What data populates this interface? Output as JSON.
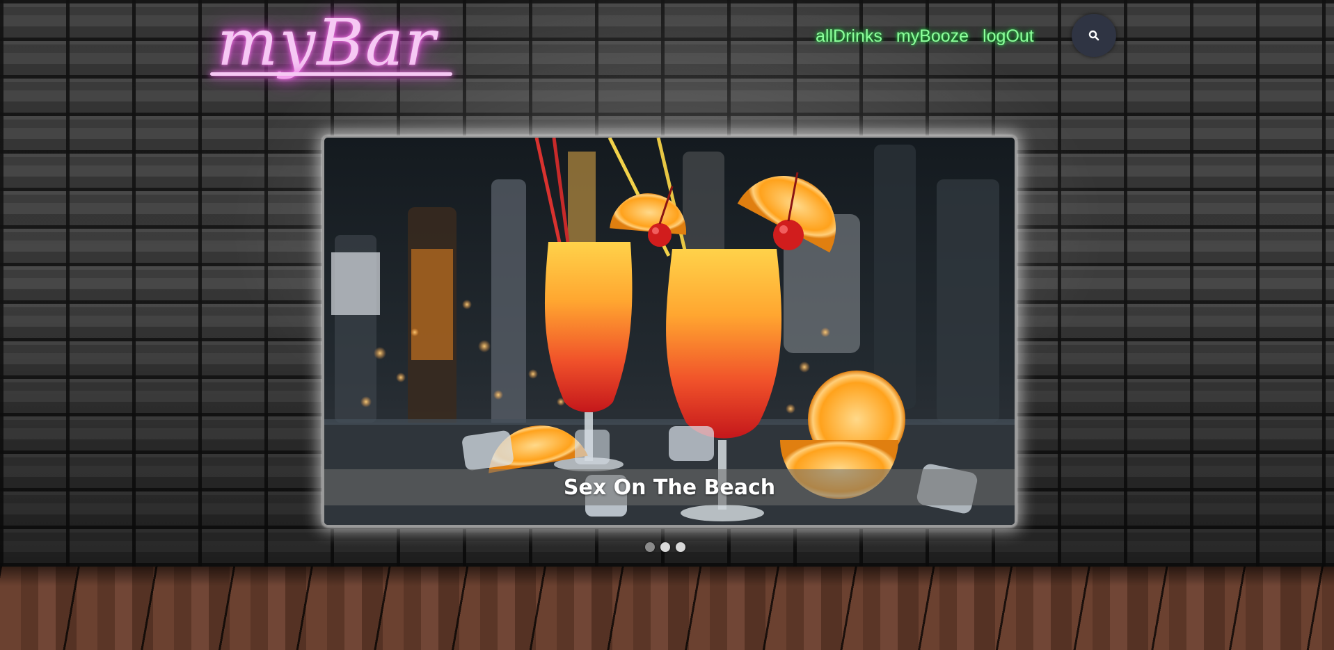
{
  "header": {
    "logo_text": "myBar",
    "nav": [
      {
        "label": "allDrinks"
      },
      {
        "label": "myBooze"
      },
      {
        "label": "logOut"
      }
    ],
    "search_icon": "search-icon"
  },
  "carousel": {
    "slides": [
      {
        "caption": "Sex On The Beach"
      }
    ],
    "indicators": {
      "count": 3,
      "active_index": 1
    }
  },
  "colors": {
    "logo_neon": "#f6c9f4",
    "nav_neon": "#8dff9c",
    "search_button_bg": "#2f3443",
    "caption_text": "#ffffff"
  }
}
